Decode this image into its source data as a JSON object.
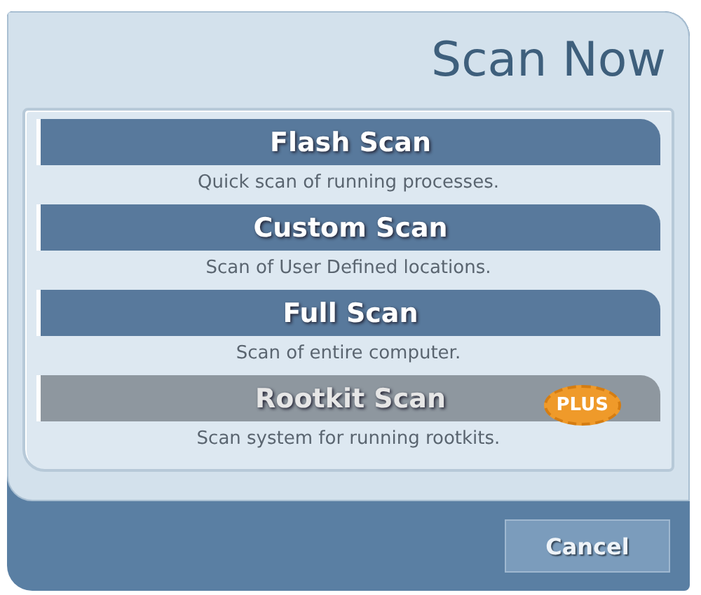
{
  "dialog": {
    "title": "Scan Now"
  },
  "scans": [
    {
      "name": "Flash Scan",
      "description": "Quick scan of running processes.",
      "disabled": false
    },
    {
      "name": "Custom Scan",
      "description": "Scan of User Defined locations.",
      "disabled": false
    },
    {
      "name": "Full Scan",
      "description": "Scan of entire computer.",
      "disabled": false
    },
    {
      "name": "Rootkit Scan",
      "description": "Scan system for running rootkits.",
      "disabled": true,
      "badge": "PLUS"
    }
  ],
  "buttons": [
    {
      "label": "Cancel"
    }
  ]
}
